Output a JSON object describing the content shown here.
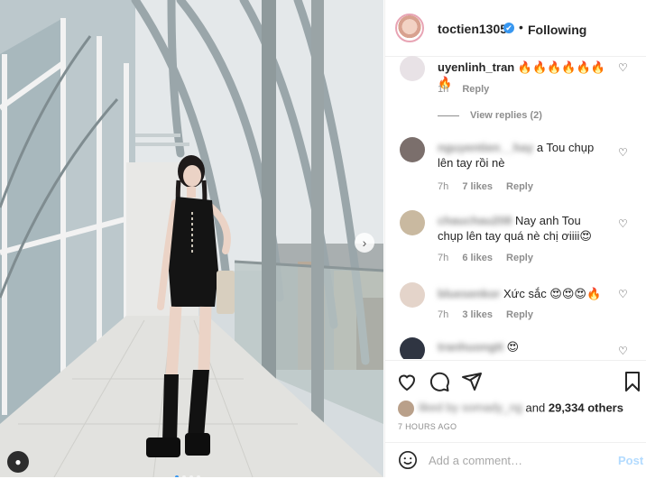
{
  "post": {
    "username": "toctien1305",
    "follow_state": "Following",
    "more_label": "•••",
    "verified_mark": "✔"
  },
  "comments": [
    {
      "user": "uyenlinh_tran",
      "text": "🔥🔥🔥🔥🔥🔥🔥",
      "time": "1h",
      "likes": "",
      "reply": "Reply",
      "view_replies": "View replies (2)"
    },
    {
      "user": "nguyentien__hay",
      "text": "a Tou chụp lên tay rồi nè",
      "time": "7h",
      "likes": "7 likes",
      "reply": "Reply"
    },
    {
      "user": "chauchau208",
      "text": "Nay anh Tou chụp lên tay quá nè chị ơiiii😍",
      "time": "7h",
      "likes": "6 likes",
      "reply": "Reply"
    },
    {
      "user": "bluesenkor",
      "text": "Xức sắc 😍😍😍🔥",
      "time": "7h",
      "likes": "3 likes",
      "reply": "Reply"
    },
    {
      "user": "tranhuongtt",
      "text": "😍",
      "time": "",
      "likes": "",
      "reply": ""
    }
  ],
  "likes": {
    "by_user": "liked by somady_ng",
    "and": "and",
    "others": "29,334 others"
  },
  "time_ago": "7 HOURS AGO",
  "add_comment": {
    "placeholder": "Add a comment…",
    "post": "Post"
  },
  "icons": {
    "like": "heart-icon",
    "comment": "comment-icon",
    "share": "share-icon",
    "save": "bookmark-icon",
    "emoji": "emoji-icon",
    "next": "chevron-right-icon",
    "tag": "user-tag-icon"
  },
  "colors": {
    "accent": "#3897f0",
    "post_disabled": "#b3dbff",
    "muted": "#8e8e8e"
  }
}
